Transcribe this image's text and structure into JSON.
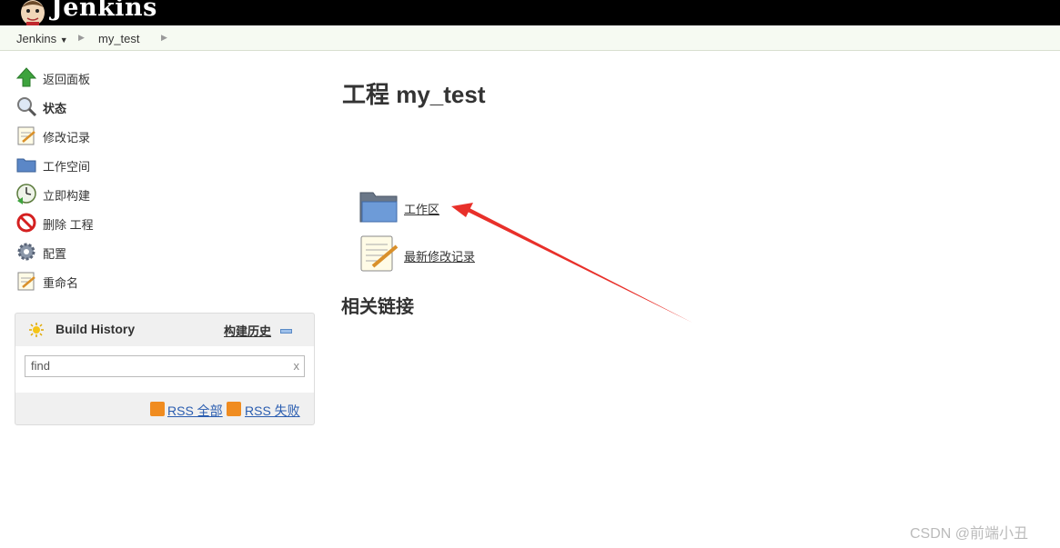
{
  "header": {
    "brand": "Jenkins"
  },
  "breadcrumb": {
    "items": [
      "Jenkins",
      "my_test"
    ]
  },
  "sidebar": {
    "tasks": [
      {
        "label": "返回面板",
        "icon": "up-arrow-icon"
      },
      {
        "label": "状态",
        "icon": "search-icon"
      },
      {
        "label": "修改记录",
        "icon": "notepad-icon"
      },
      {
        "label": "工作空间",
        "icon": "folder-icon"
      },
      {
        "label": "立即构建",
        "icon": "clock-icon"
      },
      {
        "label": "删除 工程",
        "icon": "no-entry-icon"
      },
      {
        "label": "配置",
        "icon": "gear-icon"
      },
      {
        "label": "重命名",
        "icon": "notepad-icon"
      }
    ]
  },
  "build_history": {
    "title": "Build History",
    "link": "构建历史",
    "search_value": "find",
    "clear": "x",
    "rss_all": "RSS 全部",
    "rss_failed": "RSS 失败"
  },
  "main": {
    "title": "工程 my_test",
    "workspace_link": "工作区",
    "changes_link": "最新修改记录",
    "related_heading": "相关链接"
  },
  "watermark": "CSDN @前端小丑",
  "colors": {
    "arrow": "#e8302a",
    "rss": "#f08c20",
    "link": "#2a5db0"
  }
}
